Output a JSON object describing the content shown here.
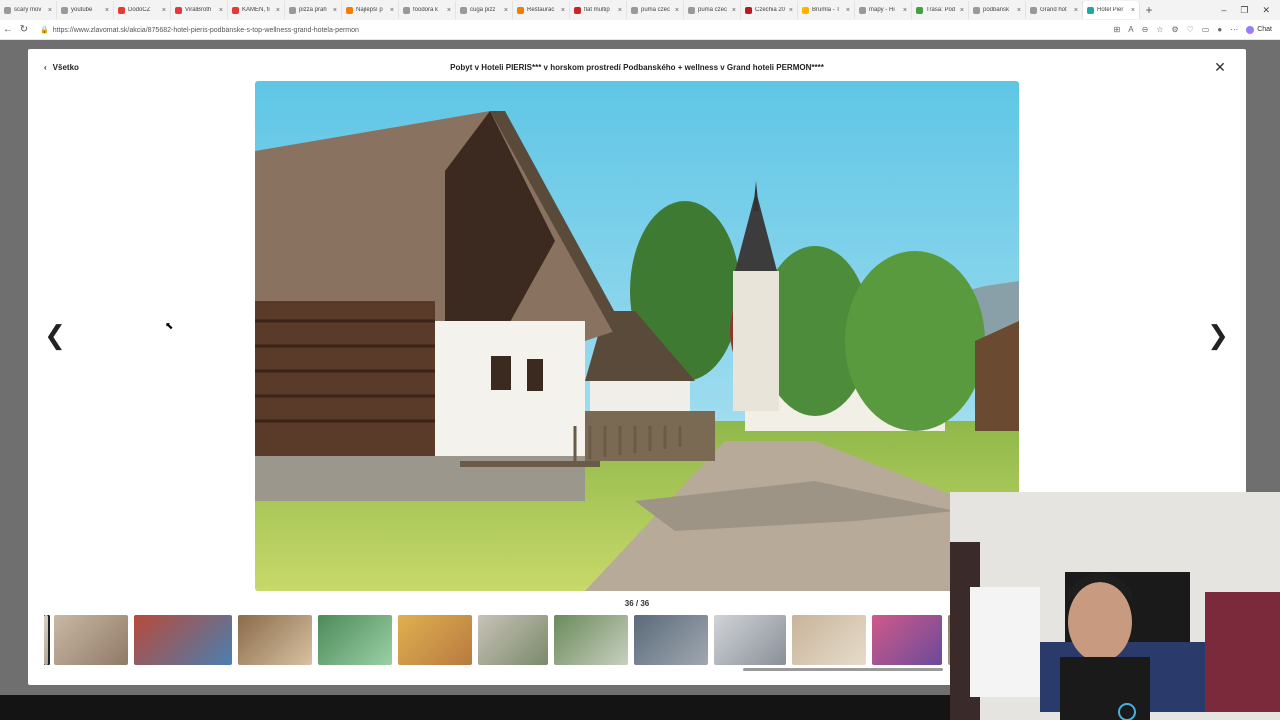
{
  "browser": {
    "tabs": [
      {
        "label": "scary mov",
        "color": "#999999"
      },
      {
        "label": "youtube",
        "color": "#999999"
      },
      {
        "label": "DodoCZ",
        "color": "#e53935"
      },
      {
        "label": "ViralBroth",
        "color": "#e53935"
      },
      {
        "label": "KAMEN, fi",
        "color": "#e53935"
      },
      {
        "label": "pizza prah",
        "color": "#999999"
      },
      {
        "label": "Najlepší p",
        "color": "#f57c00"
      },
      {
        "label": "foodora k",
        "color": "#999999"
      },
      {
        "label": "cuga pizz",
        "color": "#999999"
      },
      {
        "label": "Reštaurác",
        "color": "#f57c00"
      },
      {
        "label": "flat multip",
        "color": "#c62828"
      },
      {
        "label": "puma czec",
        "color": "#999999"
      },
      {
        "label": "puma czec",
        "color": "#999999"
      },
      {
        "label": "Czechia 20",
        "color": "#b71c1c"
      },
      {
        "label": "Brumla - T",
        "color": "#ffb300"
      },
      {
        "label": "mapy - Hi",
        "color": "#999999"
      },
      {
        "label": "Trasa: Pod",
        "color": "#43a047"
      },
      {
        "label": "podbansk",
        "color": "#999999"
      },
      {
        "label": "Grand hot",
        "color": "#999999"
      },
      {
        "label": "Hotel Pier",
        "color": "#26a69a",
        "active": true
      }
    ],
    "new_tab": "+",
    "url": "https://www.zlavomat.sk/akcia/875682-hotel-pieris-podbanske-s-top-wellness-grand-hotela-permon",
    "chat_label": "Chat"
  },
  "gallery": {
    "back_label": "Všetko",
    "title": "Pobyt v Hoteli PIERIS*** v horskom prostredí Podbanského + wellness v Grand hoteli PERMON****",
    "counter": "36 / 36",
    "close": "✕",
    "prev": "❮",
    "next": "❯",
    "thumbnails": [
      {
        "w": 4,
        "c1": "#d8cfc4",
        "c2": "#b5a796"
      },
      {
        "w": 74,
        "c1": "#c9b8a6",
        "c2": "#8f7a66"
      },
      {
        "w": 98,
        "c1": "#b84a3a",
        "c2": "#4a7fb0"
      },
      {
        "w": 74,
        "c1": "#8a6a4a",
        "c2": "#d7c2a2"
      },
      {
        "w": 74,
        "c1": "#4c8a5a",
        "c2": "#9bd0a4"
      },
      {
        "w": 74,
        "c1": "#e0b050",
        "c2": "#b87a40"
      },
      {
        "w": 70,
        "c1": "#c8c2b8",
        "c2": "#7a8a6a"
      },
      {
        "w": 74,
        "c1": "#6a8a5a",
        "c2": "#c8d0c0"
      },
      {
        "w": 74,
        "c1": "#5a6a7a",
        "c2": "#a0a8b0"
      },
      {
        "w": 72,
        "c1": "#d0d4d8",
        "c2": "#8a9098"
      },
      {
        "w": 74,
        "c1": "#c8b49a",
        "c2": "#e6dccb"
      },
      {
        "w": 70,
        "c1": "#d05a8a",
        "c2": "#6a4a9a"
      },
      {
        "w": 40,
        "c1": "#8a7a6a",
        "c2": "#c0b0a0"
      }
    ]
  }
}
